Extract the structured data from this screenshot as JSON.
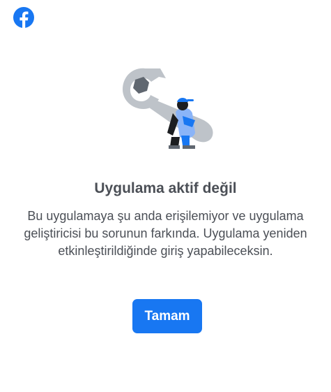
{
  "header": {
    "logo_icon": "facebook-logo-icon",
    "brand_color": "#1877f2"
  },
  "illustration": {
    "icon": "wrench-with-worker-illustration"
  },
  "dialog": {
    "title": "Uygulama aktif değil",
    "message": "Bu uygulamaya şu anda erişilemiyor ve uygulama geliştiricisi bu sorunun farkında. Uygulama yeniden etkinleştirildiğinde giriş yapabileceksin.",
    "ok_label": "Tamam"
  },
  "colors": {
    "text": "#4b4f56",
    "button": "#1877f2",
    "button_text": "#ffffff",
    "wrench": "#bec3c9"
  }
}
